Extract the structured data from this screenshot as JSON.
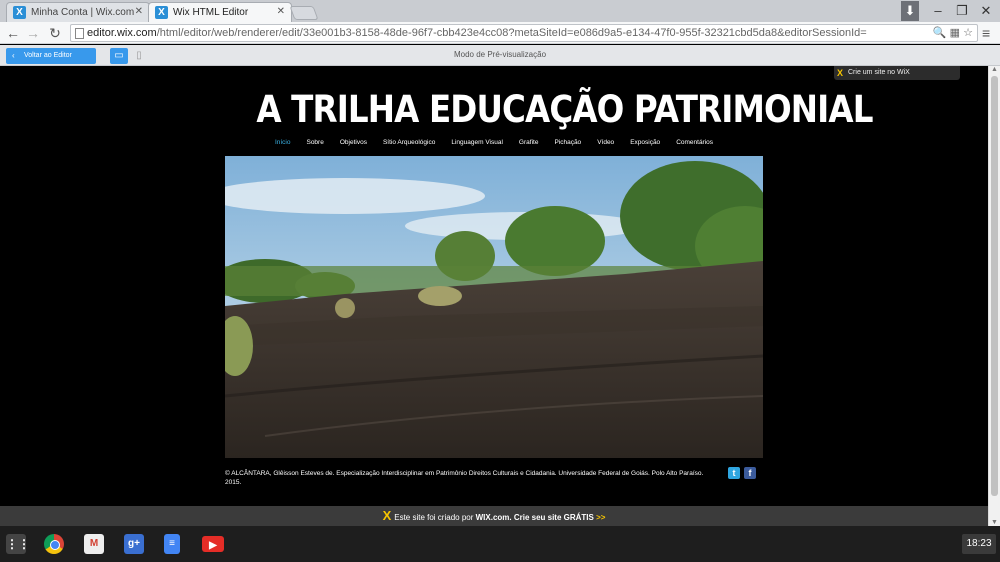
{
  "browser": {
    "tabs": [
      {
        "title": "Minha Conta | Wix.com",
        "active": false
      },
      {
        "title": "Wix HTML Editor",
        "active": true
      }
    ],
    "url_domain": "editor.wix.com",
    "url_path": "/html/editor/web/renderer/edit/33e001b3-8158-48de-96f7-cbb423e4cc08?metaSiteId=e086d9a5-e134-47f0-955f-32321cbd5da8&editorSessionId="
  },
  "preview_bar": {
    "back_button": "Voltar ao Editor",
    "title": "Modo de Pré-visualização"
  },
  "site": {
    "wix_badge": "Crie um site no WiX",
    "title": "A TRILHA EDUCAÇÃO PATRIMONIAL",
    "nav": [
      "Início",
      "Sobre",
      "Objetivos",
      "Sítio Arqueológico",
      "Linguagem Visual",
      "Grafite",
      "Pichação",
      "Vídeo",
      "Exposição",
      "Comentários"
    ],
    "active_nav": "Início",
    "caption": "© ALCÂNTARA, Glêisson Esteves de. Especialização Interdisciplinar em Patrimônio Direitos Culturais e Cidadania. Universidade Federal de Goiás. Polo Alto Paraíso. 2015.",
    "social": [
      "twitter-icon",
      "facebook-icon"
    ]
  },
  "wix_footer": {
    "text": "Este site foi criado por ",
    "brand": "WIX.com",
    "cta": ". Crie seu site GRÁTIS ",
    "arrow": ">>"
  },
  "shelf": {
    "apps": [
      "launcher-icon",
      "chrome-icon",
      "gmail-icon",
      "google-plus-icon",
      "google-docs-icon",
      "youtube-icon"
    ],
    "clock": "18:23"
  },
  "colors": {
    "accent": "#3899ec",
    "nav_active": "#3ab0e2",
    "wix_yellow": "#f7c500"
  }
}
